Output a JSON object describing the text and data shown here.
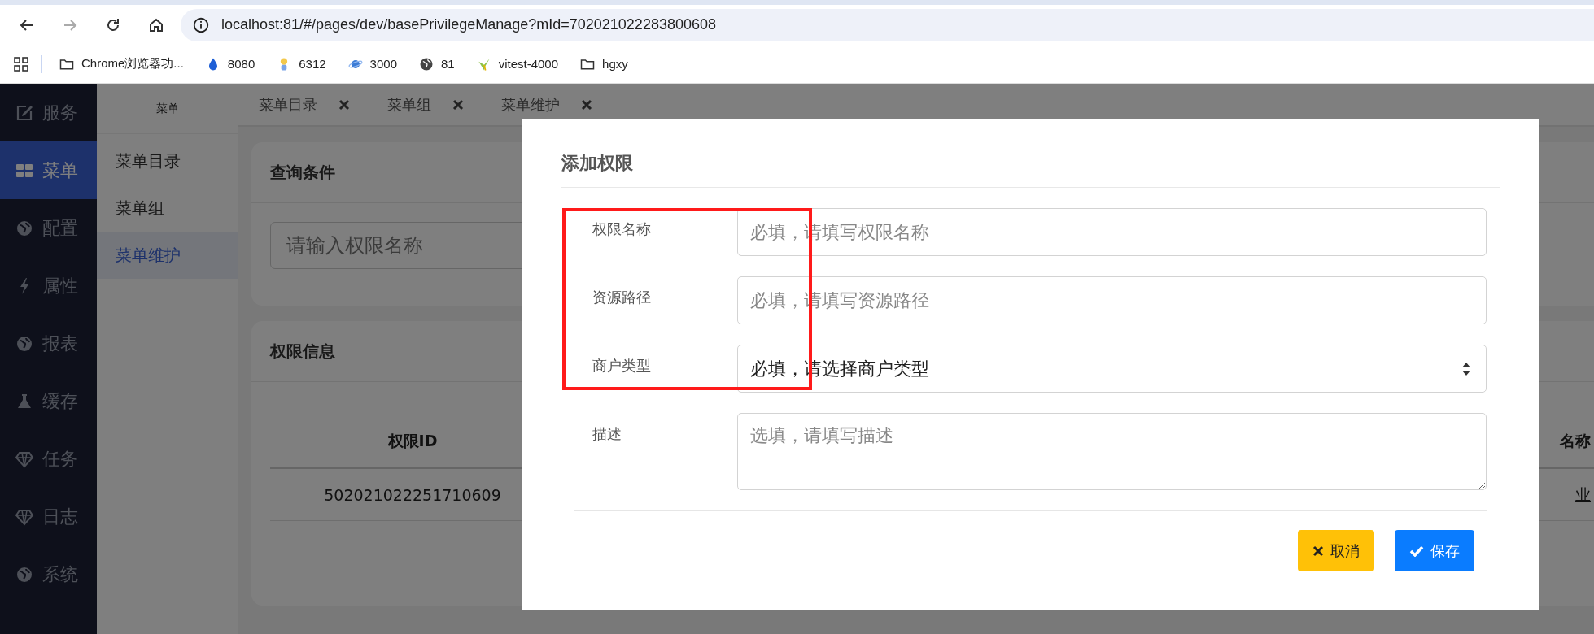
{
  "browser": {
    "nav": [
      {
        "kind": "back",
        "disabled": false
      },
      {
        "kind": "forward",
        "disabled": true
      },
      {
        "kind": "reload",
        "disabled": false
      },
      {
        "kind": "home",
        "disabled": false
      }
    ],
    "url": "localhost:81/#/pages/dev/basePrivilegeManage?mId=702021022283800608",
    "bookmarks": [
      {
        "kind": "folder",
        "label": "Chrome浏览器功..."
      },
      {
        "kind": "drop",
        "label": "8080"
      },
      {
        "kind": "figure",
        "label": "6312"
      },
      {
        "kind": "planet",
        "label": "3000"
      },
      {
        "kind": "globe",
        "label": "81"
      },
      {
        "kind": "bolt",
        "label": "vitest-4000"
      },
      {
        "kind": "folder",
        "label": "hgxy"
      }
    ]
  },
  "sidebar": {
    "items": [
      {
        "kind": "edit",
        "label": "服务",
        "selected": false
      },
      {
        "kind": "grid",
        "label": "菜单",
        "selected": true
      },
      {
        "kind": "globe",
        "label": "配置",
        "selected": false
      },
      {
        "kind": "bolt",
        "label": "属性",
        "selected": false
      },
      {
        "kind": "globe",
        "label": "报表",
        "selected": false
      },
      {
        "kind": "flask",
        "label": "缓存",
        "selected": false
      },
      {
        "kind": "diamond",
        "label": "任务",
        "selected": false
      },
      {
        "kind": "diamond",
        "label": "日志",
        "selected": false
      },
      {
        "kind": "globe",
        "label": "系统",
        "selected": false
      }
    ]
  },
  "submenu": {
    "title": "菜单",
    "items": [
      {
        "label": "菜单目录",
        "selected": false
      },
      {
        "label": "菜单组",
        "selected": false
      },
      {
        "label": "菜单维护",
        "selected": true
      }
    ]
  },
  "tabs": [
    {
      "label": "菜单目录"
    },
    {
      "label": "菜单组"
    },
    {
      "label": "菜单维护"
    }
  ],
  "query_card": {
    "title": "查询条件",
    "search": {
      "placeholder": "请输入权限名称"
    }
  },
  "info_card": {
    "title": "权限信息",
    "table": {
      "columns": [
        "权限ID",
        "名称"
      ],
      "rows": [
        [
          "502021022251710609",
          "业"
        ]
      ]
    }
  },
  "dialog": {
    "title": "添加权限",
    "fields": [
      {
        "kind": "text",
        "label": "权限名称",
        "placeholder": "必填，请填写权限名称"
      },
      {
        "kind": "text",
        "label": "资源路径",
        "placeholder": "必填，请填写资源路径"
      },
      {
        "kind": "select",
        "label": "商户类型",
        "value": "必填，请选择商户类型"
      },
      {
        "kind": "textarea",
        "label": "描述",
        "placeholder": "选填，请填写描述"
      }
    ],
    "buttons": [
      {
        "kind": "cancel",
        "label": "取消"
      },
      {
        "kind": "save",
        "label": "保存"
      }
    ]
  }
}
